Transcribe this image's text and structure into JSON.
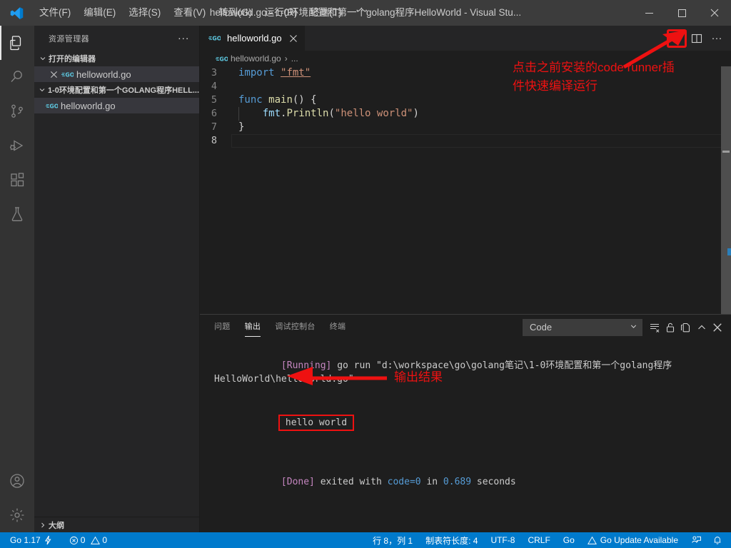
{
  "titlebar": {
    "menu": [
      {
        "label": "文件(F)",
        "name": "menu-file"
      },
      {
        "label": "编辑(E)",
        "name": "menu-edit"
      },
      {
        "label": "选择(S)",
        "name": "menu-selection"
      },
      {
        "label": "查看(V)",
        "name": "menu-view"
      },
      {
        "label": "转到(G)",
        "name": "menu-goto"
      },
      {
        "label": "运行(R)",
        "name": "menu-run"
      },
      {
        "label": "终端(T)",
        "name": "menu-terminal"
      }
    ],
    "more_label": "···",
    "title": "helloworld.go - 1-0环境配置和第一个golang程序HelloWorld - Visual Stu...",
    "minimize_label": "—",
    "maximize_label": "□",
    "close_label": "✕"
  },
  "activitybar": {
    "items": [
      {
        "icon": "explorer-icon",
        "name": "activity-explorer",
        "active": true
      },
      {
        "icon": "search-icon",
        "name": "activity-search",
        "active": false
      },
      {
        "icon": "source-control-icon",
        "name": "activity-source-control",
        "active": false
      },
      {
        "icon": "run-debug-icon",
        "name": "activity-run-debug",
        "active": false
      },
      {
        "icon": "extensions-icon",
        "name": "activity-extensions",
        "active": false
      },
      {
        "icon": "testing-icon",
        "name": "activity-testing",
        "active": false
      }
    ],
    "bottom": [
      {
        "icon": "account-icon",
        "name": "activity-account"
      },
      {
        "icon": "gear-icon",
        "name": "activity-settings"
      }
    ]
  },
  "sidebar": {
    "title": "资源管理器",
    "more_label": "···",
    "open_editors": {
      "label": "打开的编辑器",
      "expanded": true,
      "items": [
        {
          "label": "helloworld.go",
          "close_label": "✕",
          "selected": true
        }
      ]
    },
    "folder": {
      "label": "1-0环境配置和第一个GOLANG程序HELL...",
      "expanded": true,
      "items": [
        {
          "label": "helloworld.go",
          "selected": true
        }
      ]
    },
    "outline": {
      "label": "大纲",
      "expanded": false
    }
  },
  "editor": {
    "tab": {
      "label": "helloworld.go",
      "close_label": "✕"
    },
    "breadcrumb": {
      "file": "helloworld.go",
      "separator": "›",
      "rest": "..."
    },
    "actions": {
      "run_name": "run-code-button",
      "split_name": "split-editor-button",
      "more_label": "···"
    },
    "lines": [
      {
        "num": "3",
        "tokens": [
          {
            "t": "import",
            "c": "k-kw"
          },
          {
            "t": " ",
            "c": "k-pun"
          },
          {
            "t": "\"fmt\"",
            "c": "k-imp"
          }
        ]
      },
      {
        "num": "4",
        "tokens": []
      },
      {
        "num": "5",
        "tokens": [
          {
            "t": "func",
            "c": "k-kw"
          },
          {
            "t": " ",
            "c": "k-pun"
          },
          {
            "t": "main",
            "c": "k-fn"
          },
          {
            "t": "() {",
            "c": "k-pun"
          }
        ]
      },
      {
        "num": "6",
        "tokens": [
          {
            "t": "    ",
            "c": "k-pun"
          },
          {
            "t": "fmt",
            "c": "k-pkg"
          },
          {
            "t": ".",
            "c": "k-pun"
          },
          {
            "t": "Println",
            "c": "k-fn"
          },
          {
            "t": "(",
            "c": "k-pun"
          },
          {
            "t": "\"hello world\"",
            "c": "k-str"
          },
          {
            "t": ")",
            "c": "k-pun"
          }
        ]
      },
      {
        "num": "7",
        "tokens": [
          {
            "t": "}",
            "c": "k-pun"
          }
        ]
      },
      {
        "num": "8",
        "tokens": []
      }
    ]
  },
  "annotations": {
    "run_hint": "点击之前安装的code runner插\n件快速编译运行",
    "output_hint": "输出结果"
  },
  "panel": {
    "tabs": [
      {
        "label": "问题",
        "name": "panel-tab-problems",
        "active": false
      },
      {
        "label": "输出",
        "name": "panel-tab-output",
        "active": true
      },
      {
        "label": "调试控制台",
        "name": "panel-tab-debug-console",
        "active": false
      },
      {
        "label": "终端",
        "name": "panel-tab-terminal",
        "active": false
      }
    ],
    "channel_select": {
      "value": "Code",
      "chevron": "⌄"
    },
    "actions": [
      {
        "name": "clear-output-icon"
      },
      {
        "name": "unlock-icon"
      },
      {
        "name": "open-in-editor-icon"
      },
      {
        "name": "maximize-panel-icon"
      },
      {
        "name": "close-panel-icon"
      }
    ],
    "output": {
      "running_tag": "[Running]",
      "running_cmd": " go run \"d:\\workspace\\go\\golang笔记\\1-0环境配置和第一个golang程序HelloWorld\\helloworld.go\"",
      "result": "hello world",
      "done_tag": "[Done]",
      "done_pre": " exited with ",
      "done_code": "code=0",
      "done_mid": " in ",
      "done_secs": "0.689",
      "done_post": " seconds"
    }
  },
  "statusbar": {
    "left": [
      {
        "label": "Go 1.17",
        "name": "status-go-version",
        "icon": "lightning-icon"
      },
      {
        "label": "0",
        "name": "status-errors",
        "icon": "error-icon",
        "label2": "0",
        "icon2": "warning-icon"
      }
    ],
    "go_version": "Go 1.17",
    "errors": "0",
    "warnings": "0",
    "position": "行 8，列 1",
    "tabsize": "制表符长度: 4",
    "encoding": "UTF-8",
    "eol": "CRLF",
    "language": "Go",
    "update": "Go Update Available",
    "feedback_name": "status-feedback-icon",
    "bell_name": "status-notifications-icon"
  },
  "colors": {
    "accent": "#007acc",
    "annotation_red": "#ee1111",
    "titlebar_bg": "#3c3c3c",
    "sidebar_bg": "#252526",
    "editor_bg": "#1e1e1e",
    "activitybar_bg": "#333333"
  }
}
